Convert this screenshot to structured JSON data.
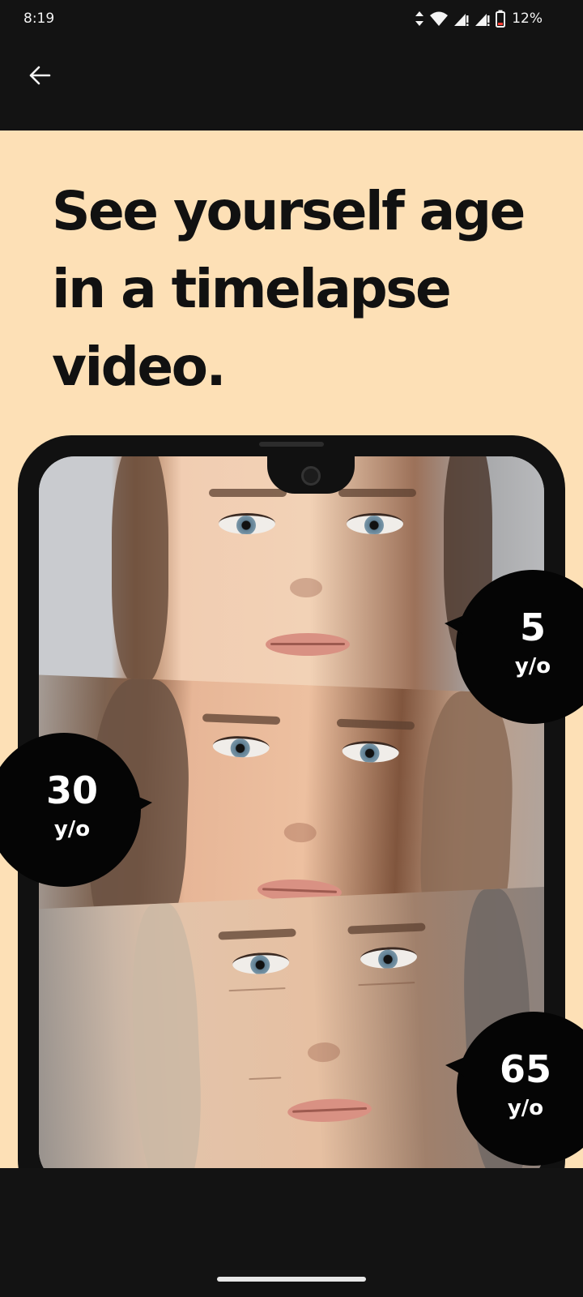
{
  "status_bar": {
    "time": "8:19",
    "battery": "12%",
    "icons": [
      "data-arrows-icon",
      "wifi-icon",
      "signal-icon",
      "signal-icon",
      "battery-low-icon"
    ]
  },
  "app_bar": {
    "back_icon": "arrow-left-icon"
  },
  "promo": {
    "headline": "See yourself age in a timelapse video.",
    "age_labels": [
      {
        "value": "5",
        "unit": "y/o"
      },
      {
        "value": "30",
        "unit": "y/o"
      },
      {
        "value": "65",
        "unit": "y/o"
      }
    ]
  },
  "colors": {
    "background": "#fde0b6",
    "chrome": "#131313",
    "bubble": "#050505"
  }
}
